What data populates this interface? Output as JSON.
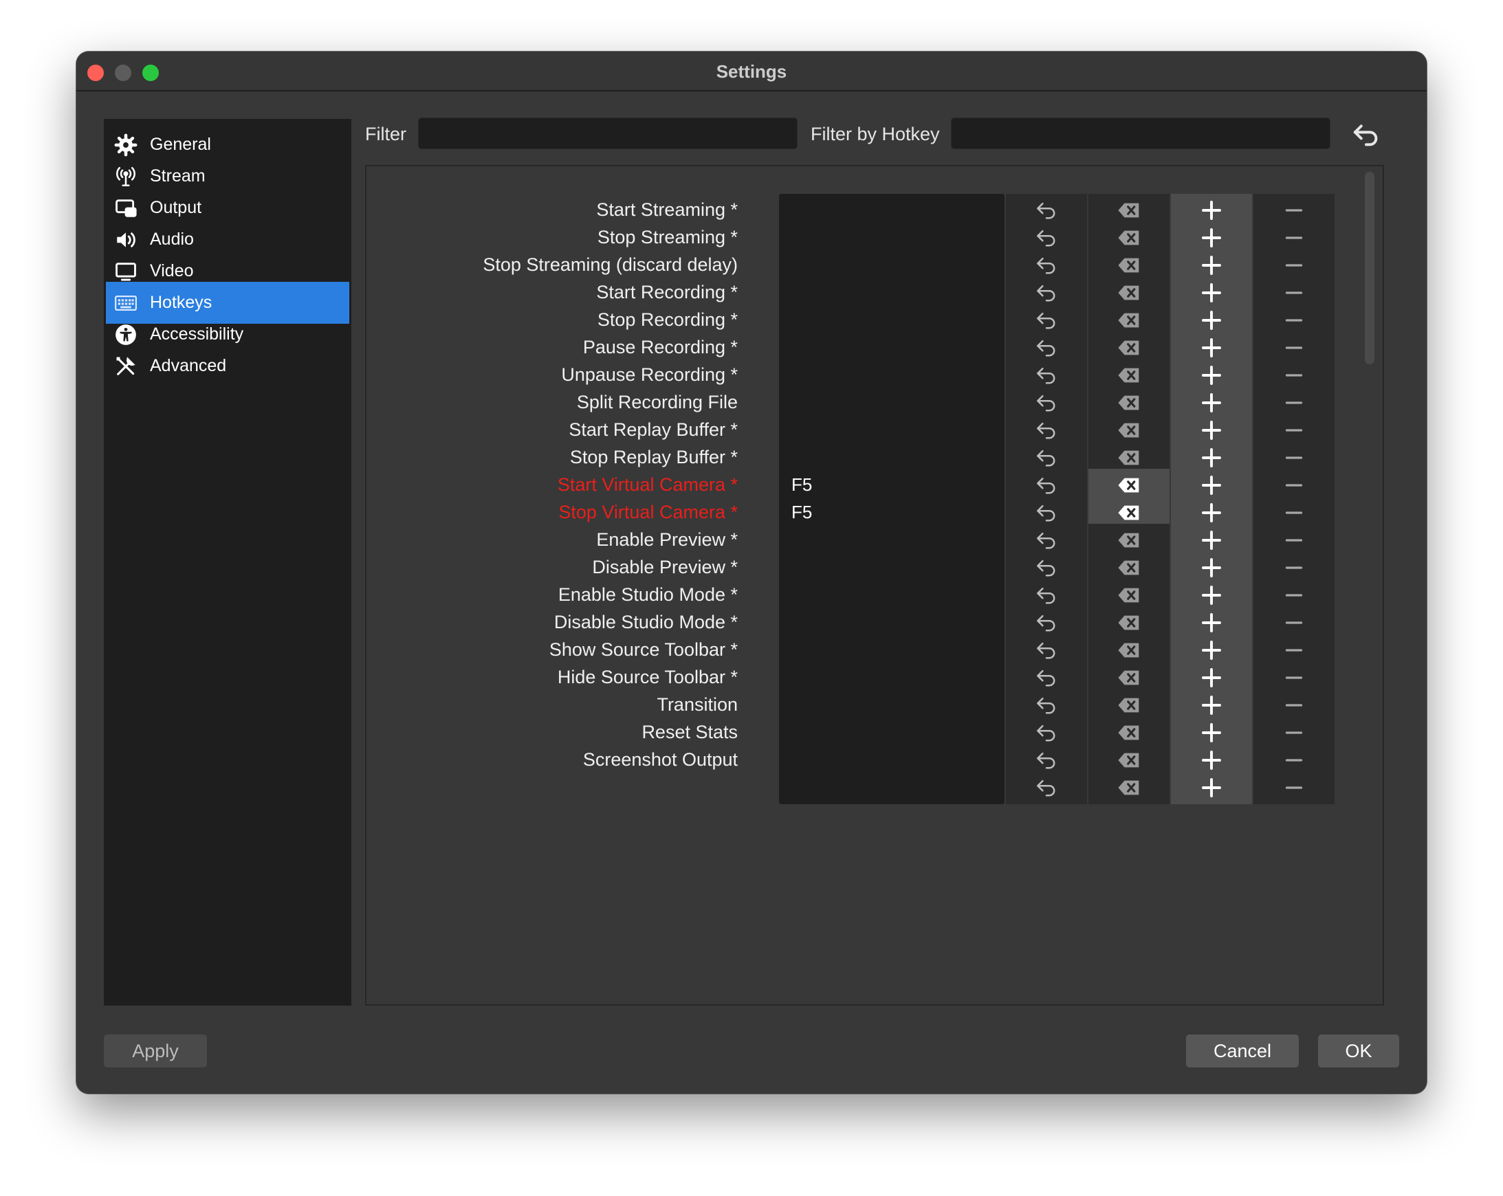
{
  "window": {
    "title": "Settings"
  },
  "sidebar": {
    "items": [
      {
        "label": "General",
        "icon": "gear-icon",
        "active": false
      },
      {
        "label": "Stream",
        "icon": "antenna-icon",
        "active": false
      },
      {
        "label": "Output",
        "icon": "output-icon",
        "active": false
      },
      {
        "label": "Audio",
        "icon": "speaker-icon",
        "active": false
      },
      {
        "label": "Video",
        "icon": "monitor-icon",
        "active": false
      },
      {
        "label": "Hotkeys",
        "icon": "keyboard-icon",
        "active": true
      },
      {
        "label": "Accessibility",
        "icon": "accessibility-icon",
        "active": false
      },
      {
        "label": "Advanced",
        "icon": "tools-icon",
        "active": false
      }
    ]
  },
  "filters": {
    "filter_label": "Filter",
    "filter_value": "",
    "hotkey_filter_label": "Filter by Hotkey",
    "hotkey_filter_value": ""
  },
  "hotkeys": [
    {
      "label": "Start Streaming *",
      "key": "",
      "conflict": false
    },
    {
      "label": "Stop Streaming *",
      "key": "",
      "conflict": false
    },
    {
      "label": "Stop Streaming (discard delay)",
      "key": "",
      "conflict": false
    },
    {
      "label": "Start Recording *",
      "key": "",
      "conflict": false
    },
    {
      "label": "Stop Recording *",
      "key": "",
      "conflict": false
    },
    {
      "label": "Pause Recording *",
      "key": "",
      "conflict": false
    },
    {
      "label": "Unpause Recording *",
      "key": "",
      "conflict": false
    },
    {
      "label": "Split Recording File",
      "key": "",
      "conflict": false
    },
    {
      "label": "Start Replay Buffer *",
      "key": "",
      "conflict": false
    },
    {
      "label": "Stop Replay Buffer *",
      "key": "",
      "conflict": false
    },
    {
      "label": "Start Virtual Camera *",
      "key": "F5",
      "conflict": true
    },
    {
      "label": "Stop Virtual Camera *",
      "key": "F5",
      "conflict": true
    },
    {
      "label": "Enable Preview *",
      "key": "",
      "conflict": false
    },
    {
      "label": "Disable Preview *",
      "key": "",
      "conflict": false
    },
    {
      "label": "Enable Studio Mode *",
      "key": "",
      "conflict": false
    },
    {
      "label": "Disable Studio Mode *",
      "key": "",
      "conflict": false
    },
    {
      "label": "Show Source Toolbar *",
      "key": "",
      "conflict": false
    },
    {
      "label": "Hide Source Toolbar *",
      "key": "",
      "conflict": false
    },
    {
      "label": "Transition",
      "key": "",
      "conflict": false
    },
    {
      "label": "Reset Stats",
      "key": "",
      "conflict": false
    },
    {
      "label": "Screenshot Output",
      "key": "",
      "conflict": false
    },
    {
      "label": "",
      "key": "",
      "conflict": false
    }
  ],
  "footer": {
    "apply": "Apply",
    "cancel": "Cancel",
    "ok": "OK"
  },
  "colors": {
    "accent": "#2b7fe0",
    "conflict": "#e8201b",
    "panel": "#1e1e1e",
    "window": "#383838"
  }
}
